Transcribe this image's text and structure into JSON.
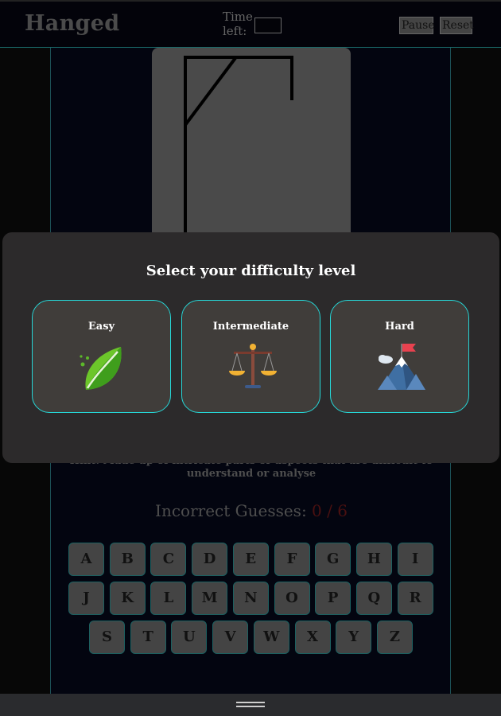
{
  "header": {
    "title": "Hanged",
    "time_label": "Time left:",
    "time_value": "",
    "pause_label": "Pause",
    "reset_label": "Reset"
  },
  "game": {
    "hint": "Hint: Made up of intricate parts or aspects that are difficult to understand or analyse",
    "incorrect_label": "Incorrect Guesses:",
    "incorrect_count": "0 / 6",
    "keyboard_rows": [
      [
        "A",
        "B",
        "C",
        "D",
        "E",
        "F",
        "G",
        "H",
        "I"
      ],
      [
        "J",
        "K",
        "L",
        "M",
        "N",
        "O",
        "P",
        "Q",
        "R"
      ],
      [
        "S",
        "T",
        "U",
        "V",
        "W",
        "X",
        "Y",
        "Z"
      ]
    ]
  },
  "modal": {
    "title": "Select your difficulty level",
    "options": [
      {
        "label": "Easy",
        "icon": "leaf-icon"
      },
      {
        "label": "Intermediate",
        "icon": "balance-scale-icon"
      },
      {
        "label": "Hard",
        "icon": "mountain-flag-icon"
      }
    ]
  },
  "colors": {
    "accent": "#26d6d6",
    "modal_bg": "#2c2a2b",
    "card_bg": "#403d3a",
    "incorrect_count": "#4a1010"
  }
}
